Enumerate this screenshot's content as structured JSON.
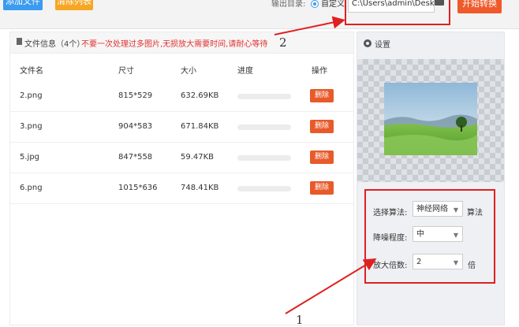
{
  "toolbar": {
    "add_files": "添加文件",
    "clear_list": "清除列表",
    "output_dir_label": "输出目录:",
    "custom_radio": "自定义",
    "path_value": "C:\\Users\\admin\\Deskto",
    "convert": "开始转换"
  },
  "files": {
    "title": "文件信息（4个）",
    "warning": "不要一次处理过多图片,无损放大需要时间,请耐心等待",
    "columns": [
      "文件名",
      "尺寸",
      "大小",
      "进度",
      "操作"
    ],
    "rows": [
      {
        "name": "2.png",
        "dims": "815*529",
        "size": "632.69KB",
        "action": "删除"
      },
      {
        "name": "3.png",
        "dims": "904*583",
        "size": "671.84KB",
        "action": "删除"
      },
      {
        "name": "5.jpg",
        "dims": "847*558",
        "size": "59.47KB",
        "action": "删除"
      },
      {
        "name": "6.png",
        "dims": "1015*636",
        "size": "748.41KB",
        "action": "删除"
      }
    ]
  },
  "settings": {
    "title": "设置",
    "algorithm_label": "选择算法:",
    "algorithm_value": "神经网络",
    "algorithm_suffix": "算法",
    "denoise_label": "降噪程度:",
    "denoise_value": "中",
    "scale_label": "放大倍数:",
    "scale_value": "2",
    "scale_suffix": "倍"
  },
  "annotations": {
    "one": "1",
    "two": "2"
  },
  "colors": {
    "accent_blue": "#3a9bf0",
    "clear_orange": "#f5a623",
    "convert_red": "#f05a2b",
    "delete_red": "#e85a2a",
    "highlight_red": "#e02020"
  }
}
